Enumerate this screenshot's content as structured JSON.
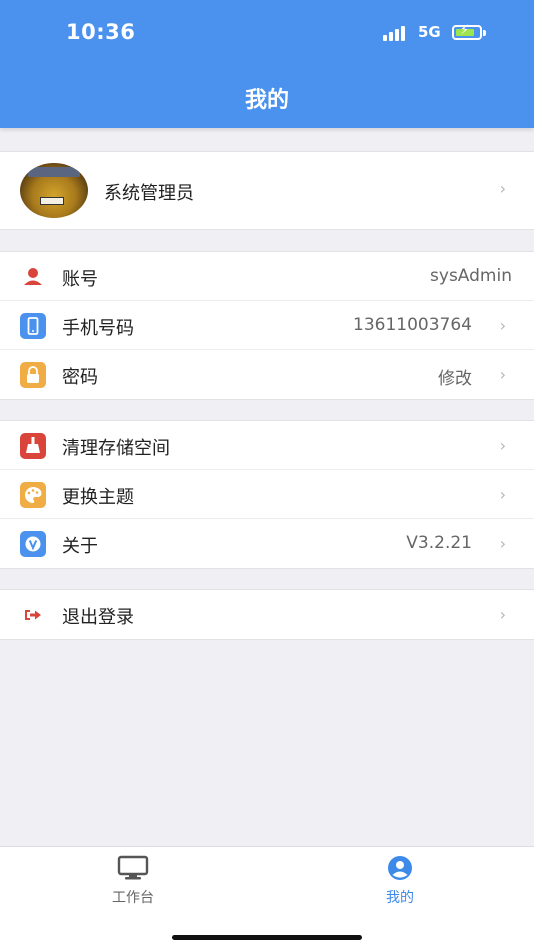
{
  "status_bar": {
    "time": "10:36",
    "network": "5G"
  },
  "header": {
    "title": "我的"
  },
  "profile": {
    "name": "系统管理员"
  },
  "account_group": [
    {
      "label": "账号",
      "value": "sysAdmin",
      "icon": "user-icon",
      "color": "#d9443b"
    },
    {
      "label": "手机号码",
      "value": "13611003764",
      "icon": "phone-icon",
      "color": "#4a92ee"
    },
    {
      "label": "密码",
      "value": "修改",
      "icon": "lock-icon",
      "color": "#f0ad45"
    }
  ],
  "settings_group": [
    {
      "label": "清理存储空间",
      "value": "",
      "icon": "broom-icon",
      "color": "#d9443b"
    },
    {
      "label": "更换主题",
      "value": "",
      "icon": "palette-icon",
      "color": "#f0ad45"
    },
    {
      "label": "关于",
      "value": "V3.2.21",
      "icon": "about-icon",
      "color": "#4a92ee"
    }
  ],
  "logout": {
    "label": "退出登录",
    "icon": "logout-icon",
    "color": "#d9443b"
  },
  "tabbar": {
    "tabs": [
      {
        "label": "工作台",
        "icon": "monitor-icon",
        "active": false
      },
      {
        "label": "我的",
        "icon": "user-circle-icon",
        "active": true
      }
    ],
    "active_color": "#3d8ae8"
  }
}
